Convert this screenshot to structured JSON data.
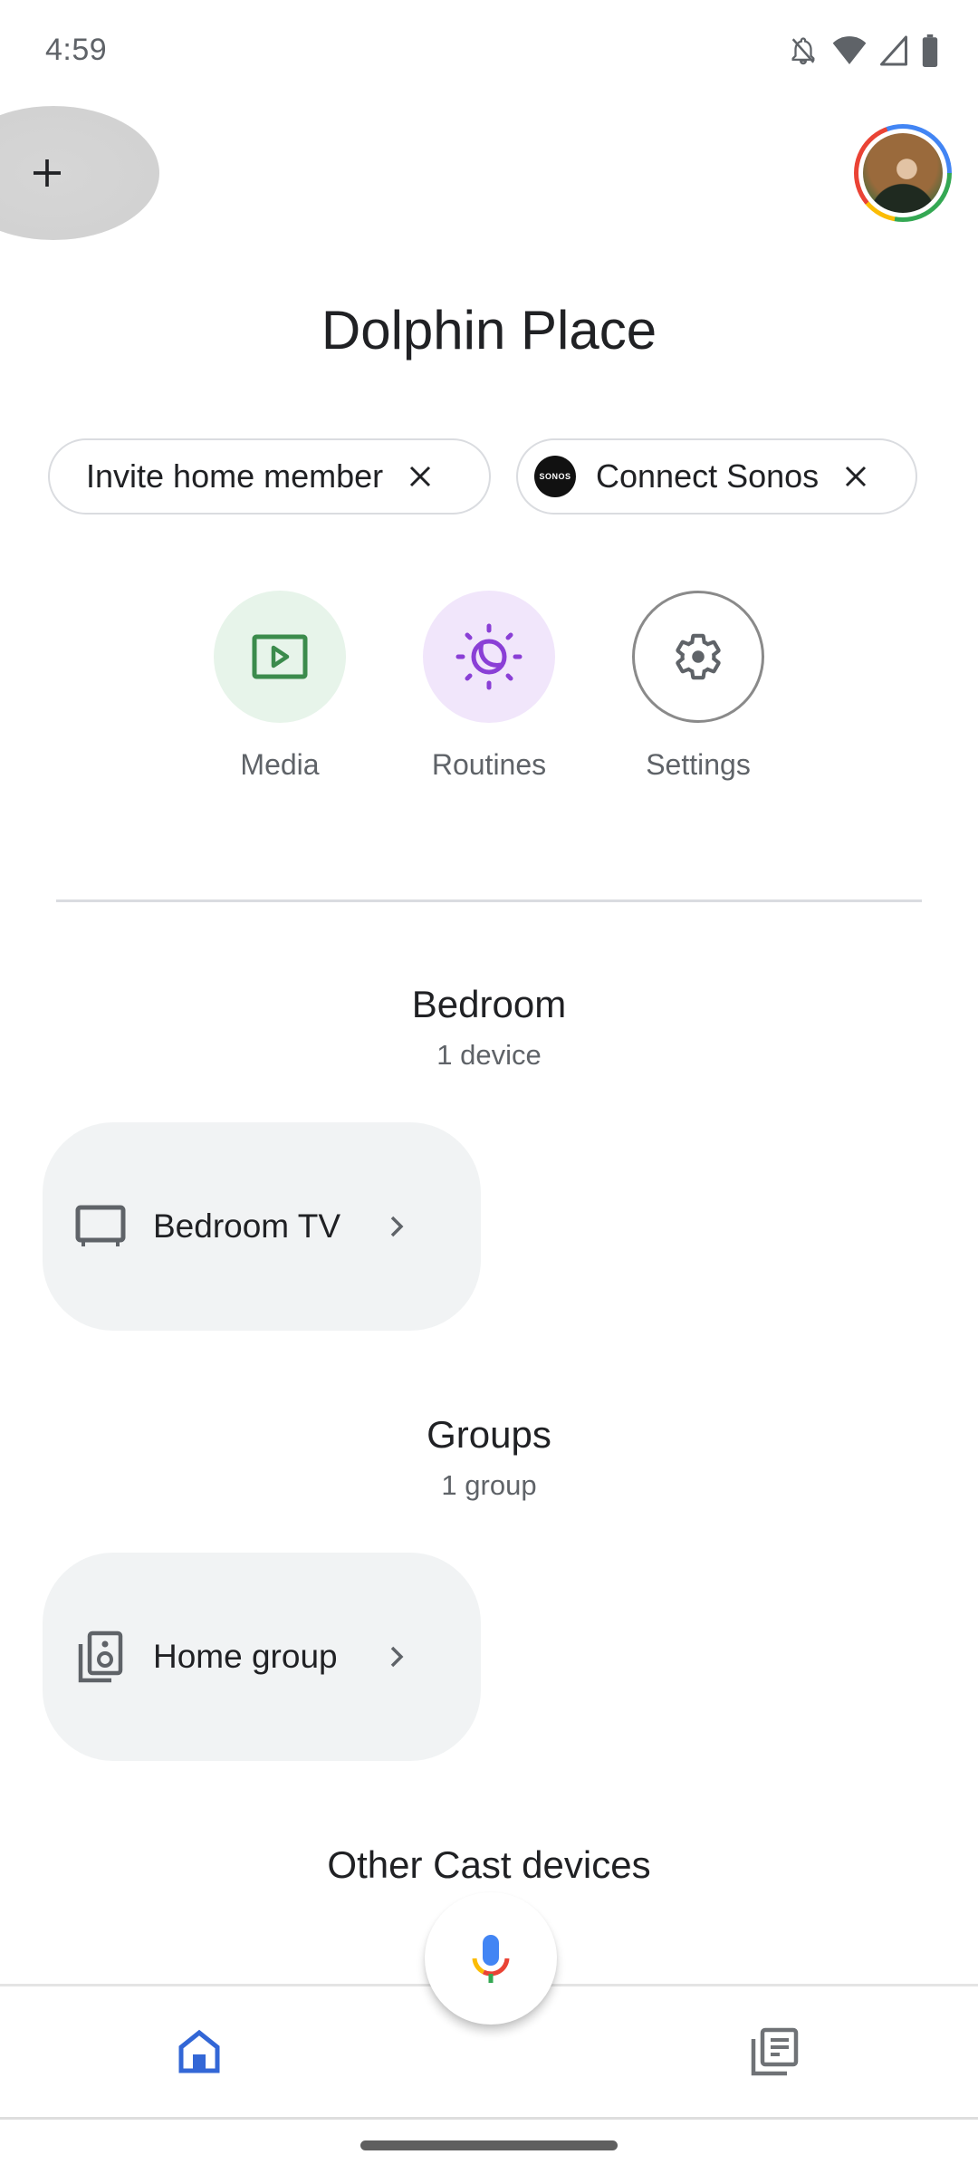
{
  "status_bar": {
    "time": "4:59",
    "icons": [
      "notifications-off-icon",
      "wifi-icon",
      "cellular-signal-icon",
      "battery-icon"
    ]
  },
  "app_bar": {
    "add_icon": "plus-icon",
    "avatar": "account-avatar"
  },
  "home": {
    "title": "Dolphin Place"
  },
  "chips": [
    {
      "label": "Invite home member",
      "close_icon": "close-icon"
    },
    {
      "label": "Connect Sonos",
      "logo_text": "SONOS",
      "close_icon": "close-icon"
    }
  ],
  "actions": [
    {
      "label": "Media",
      "icon": "play-box-icon",
      "color": "#3b8b4c",
      "bg": "#e7f4ea"
    },
    {
      "label": "Routines",
      "icon": "sun-moon-icon",
      "color": "#8a3fd6",
      "bg": "#f1e6fb"
    },
    {
      "label": "Settings",
      "icon": "gear-icon",
      "color": "#5f6368",
      "bg": "#ffffff"
    }
  ],
  "sections": [
    {
      "title": "Bedroom",
      "subtitle": "1 device",
      "items": [
        {
          "name": "Bedroom TV",
          "icon": "tv-icon"
        }
      ]
    },
    {
      "title": "Groups",
      "subtitle": "1 group",
      "items": [
        {
          "name": "Home group",
          "icon": "speaker-group-icon"
        }
      ]
    },
    {
      "title": "Other Cast devices"
    }
  ],
  "bottom_nav": {
    "items": [
      {
        "name": "Home",
        "icon": "home-icon",
        "active": true,
        "color": "#3367d6"
      },
      {
        "name": "Feed",
        "icon": "feed-icon",
        "active": false,
        "color": "#6f7276"
      }
    ],
    "mic_icon": "google-mic-icon"
  }
}
